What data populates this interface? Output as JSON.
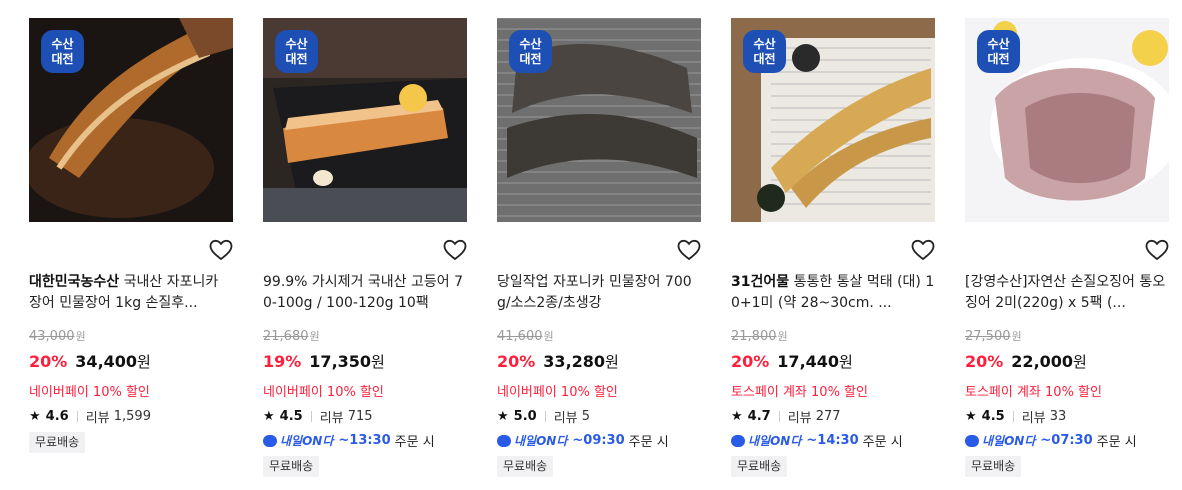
{
  "badge": {
    "line1": "수산",
    "line2": "대전",
    "color": "#1d4fb5"
  },
  "accent_color": "#ff1f3b",
  "delivery_color": "#2a5be8",
  "products": [
    {
      "brand": "대한민국농수산",
      "title": " 국내산 자포니카 장어 민물장어 1kg 손질후...",
      "original_price": "43,000",
      "original_unit": "원",
      "discount": "20%",
      "price": "34,400",
      "price_unit": "원",
      "promo": "네이버페이 10% 할인",
      "rating": "4.6",
      "review_label": "리뷰",
      "review_count": "1,599",
      "delivery": null,
      "tag": "무료배송"
    },
    {
      "brand": "",
      "title": "99.9% 가시제거 국내산 고등어 70-100g / 100-120g 10팩",
      "original_price": "21,680",
      "original_unit": "원",
      "discount": "19%",
      "price": "17,350",
      "price_unit": "원",
      "promo": "네이버페이 10% 할인",
      "rating": "4.5",
      "review_label": "리뷰",
      "review_count": "715",
      "delivery": {
        "logo": "내일ON다",
        "time": "~13:30",
        "suffix": "주문 시"
      },
      "tag": "무료배송"
    },
    {
      "brand": "",
      "title": "당일작업 자포니카 민물장어 700g/소스2종/초생강",
      "original_price": "41,600",
      "original_unit": "원",
      "discount": "20%",
      "price": "33,280",
      "price_unit": "원",
      "promo": "네이버페이 10% 할인",
      "rating": "5.0",
      "review_label": "리뷰",
      "review_count": "5",
      "delivery": {
        "logo": "내일ON다",
        "time": "~09:30",
        "suffix": "주문 시"
      },
      "tag": "무료배송"
    },
    {
      "brand": "31건어물",
      "title": " 통통한 통살 먹태 (대) 10+1미 (약 28~30cm. ...",
      "original_price": "21,800",
      "original_unit": "원",
      "discount": "20%",
      "price": "17,440",
      "price_unit": "원",
      "promo": "토스페이 계좌 10% 할인",
      "rating": "4.7",
      "review_label": "리뷰",
      "review_count": "277",
      "delivery": {
        "logo": "내일ON다",
        "time": "~14:30",
        "suffix": "주문 시"
      },
      "tag": "무료배송"
    },
    {
      "brand": "",
      "title": "[강영수산]자연산 손질오징어 통오징어 2미(220g) x 5팩 (...",
      "original_price": "27,500",
      "original_unit": "원",
      "discount": "20%",
      "price": "22,000",
      "price_unit": "원",
      "promo": "토스페이 계좌 10% 할인",
      "rating": "4.5",
      "review_label": "리뷰",
      "review_count": "33",
      "delivery": {
        "logo": "내일ON다",
        "time": "~07:30",
        "suffix": "주문 시"
      },
      "tag": "무료배송"
    }
  ]
}
